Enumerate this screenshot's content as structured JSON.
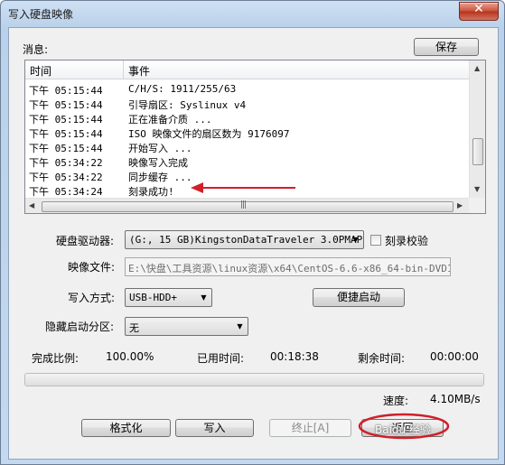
{
  "window": {
    "title": "写入硬盘映像",
    "close_glyph": "✕"
  },
  "log": {
    "label": "消息:",
    "save_button": "保存",
    "columns": [
      "时间",
      "事件"
    ],
    "rows": [
      {
        "time": "下午 05:15:44",
        "event": "C/H/S: 1911/255/63"
      },
      {
        "time": "下午 05:15:44",
        "event": "引导扇区: Syslinux v4"
      },
      {
        "time": "下午 05:15:44",
        "event": "正在准备介质 ..."
      },
      {
        "time": "下午 05:15:44",
        "event": "ISO 映像文件的扇区数为 9176097"
      },
      {
        "time": "下午 05:15:44",
        "event": "开始写入 ..."
      },
      {
        "time": "下午 05:34:22",
        "event": "映像写入完成"
      },
      {
        "time": "下午 05:34:22",
        "event": "同步缓存 ..."
      },
      {
        "time": "下午 05:34:24",
        "event": "刻录成功!"
      }
    ]
  },
  "form": {
    "drive_label": "硬盘驱动器:",
    "drive_value": "(G:, 15 GB)KingstonDataTraveler 3.0PMAP",
    "verify_label": "刻录校验",
    "image_label": "映像文件:",
    "image_value": "E:\\快盘\\工具资源\\linux资源\\x64\\CentOS-6.6-x86_64-bin-DVD1.i",
    "write_method_label": "写入方式:",
    "write_method_value": "USB-HDD+",
    "quick_boot_button": "便捷启动",
    "hidden_partition_label": "隐藏启动分区:",
    "hidden_partition_value": "无"
  },
  "progress": {
    "complete_label": "完成比例:",
    "complete_value": "100.00%",
    "elapsed_label": "已用时间:",
    "elapsed_value": "00:18:38",
    "remaining_label": "剩余时间:",
    "remaining_value": "00:00:00",
    "fraction": 1.0,
    "speed_label": "速度:",
    "speed_value": "4.10MB/s"
  },
  "buttons": {
    "format": "格式化",
    "write": "写入",
    "abort": "终止[A]",
    "back": "返回"
  },
  "icons": {
    "dropdown": "chevron-down-icon",
    "scroll_up": "scroll-up-icon",
    "scroll_down": "scroll-down-icon",
    "scroll_left": "scroll-left-icon",
    "scroll_right": "scroll-right-icon"
  },
  "watermark": "Baidu 经验",
  "colors": {
    "annotation": "#d0202a",
    "title_bar": "#c4d8ef"
  }
}
